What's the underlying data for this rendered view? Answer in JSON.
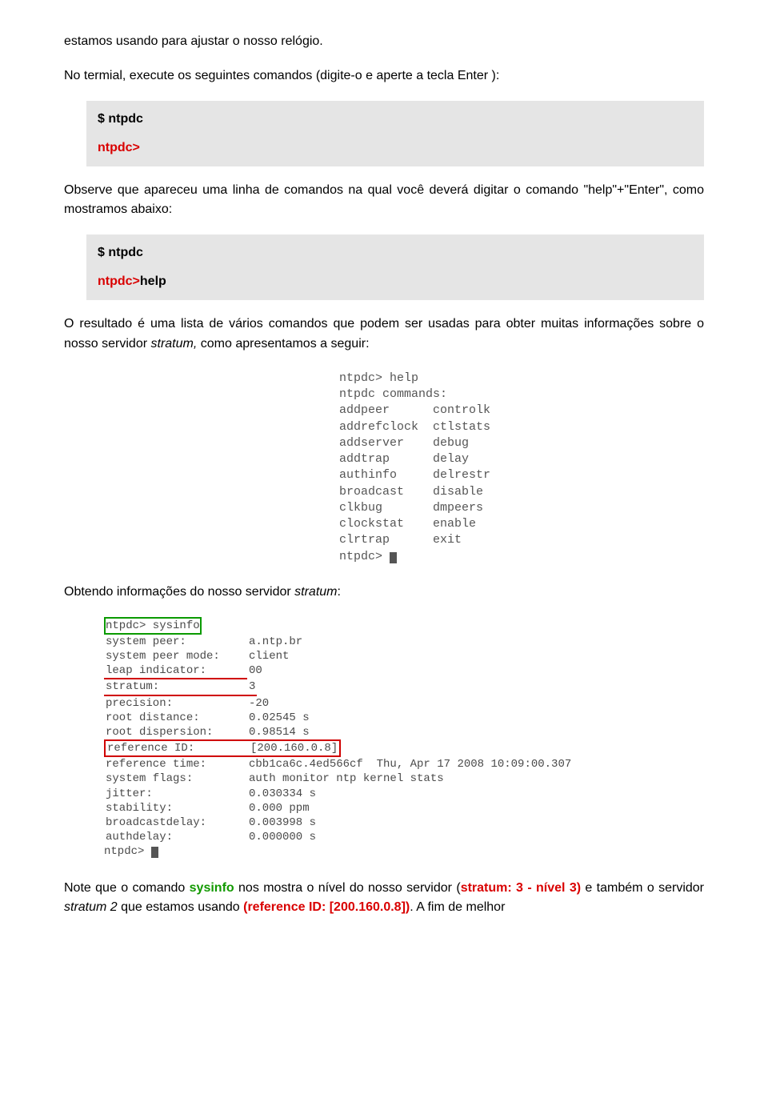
{
  "p_intro": "estamos usando para ajustar o nosso relógio.",
  "p_cmd1": "No termial, execute os seguintes comandos (digite-o e aperte a tecla Enter ):",
  "code1": {
    "dollar": "$ ntpdc",
    "prompt": "ntpdc>"
  },
  "p_cmd2": "Observe que apareceu uma linha de comandos na qual você deverá digitar o comando \"help\"+\"Enter\", como mostramos abaixo:",
  "code2": {
    "dollar": "$ ntpdc",
    "prompt": "ntpdc>",
    "help": "help"
  },
  "p_result_a": "O resultado é uma lista de vários comandos que podem ser usadas para obter muitas informações sobre o nosso servidor ",
  "p_result_b": "stratum,",
  "p_result_c": " como apresentamos a seguir:",
  "terminal_help": "ntpdc> help\nntpdc commands:\naddpeer      controlk\naddrefclock  ctlstats\naddserver    debug\naddtrap      delay\nauthinfo     delrestr\nbroadcast    disable\nclkbug       dmpeers\nclockstat    enable\nclrtrap      exit\nntpdc> ",
  "p_obtain_a": "Obtendo informações do nosso servidor ",
  "p_obtain_b": "stratum",
  "p_obtain_c": ":",
  "sysinfo": {
    "header": "ntpdc> sysinfo",
    "rows": [
      {
        "label": "system peer:",
        "value": "a.ntp.br"
      },
      {
        "label": "system peer mode:",
        "value": "client"
      },
      {
        "label": "leap indicator:",
        "value": "00"
      },
      {
        "label": "stratum:",
        "value": "3"
      },
      {
        "label": "precision:",
        "value": "-20"
      },
      {
        "label": "root distance:",
        "value": "0.02545 s"
      },
      {
        "label": "root dispersion:",
        "value": "0.98514 s"
      },
      {
        "label": "reference ID:",
        "value": "[200.160.0.8]"
      },
      {
        "label": "reference time:",
        "value": "cbb1ca6c.4ed566cf  Thu, Apr 17 2008 10:09:00.307"
      },
      {
        "label": "system flags:",
        "value": "auth monitor ntp kernel stats"
      },
      {
        "label": "jitter:",
        "value": "0.030334 s"
      },
      {
        "label": "stability:",
        "value": "0.000 ppm"
      },
      {
        "label": "broadcastdelay:",
        "value": "0.003998 s"
      },
      {
        "label": "authdelay:",
        "value": "0.000000 s"
      }
    ],
    "footer": "ntpdc> "
  },
  "final": {
    "a": "Note que o comando ",
    "sysinfo": "sysinfo",
    "b": " nos mostra o nível do nosso servidor (",
    "stratum3": "stratum: 3 - nível 3)",
    "c": " e também o servidor ",
    "stratum2": "stratum 2",
    "d": " que estamos usando ",
    "refid": "(reference ID: [200.160.0.8])",
    "e": ". A fim de melhor"
  }
}
